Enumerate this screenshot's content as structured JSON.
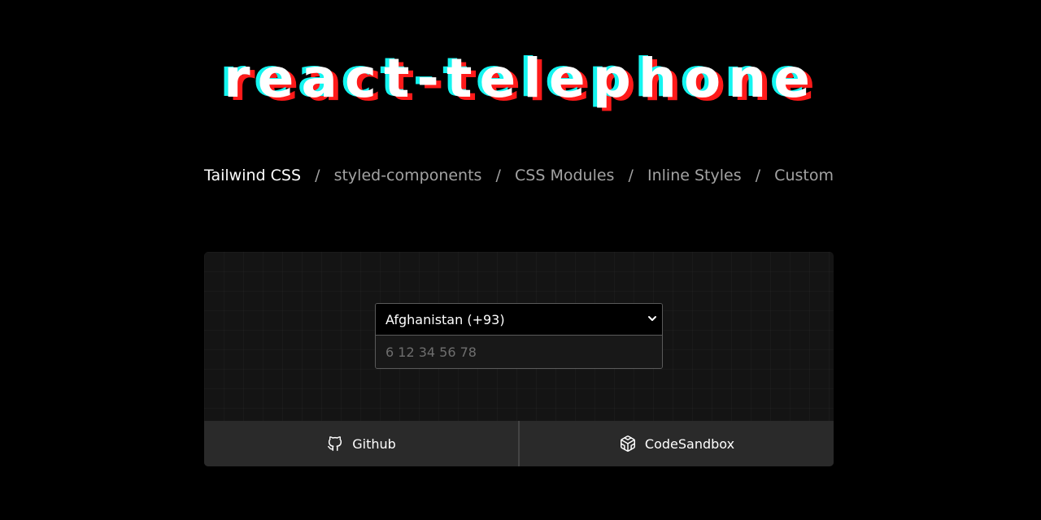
{
  "header": {
    "title": "react-telephone"
  },
  "nav": {
    "tabs": [
      {
        "label": "Tailwind CSS",
        "active": true
      },
      {
        "label": "styled-components",
        "active": false
      },
      {
        "label": "CSS Modules",
        "active": false
      },
      {
        "label": "Inline Styles",
        "active": false
      },
      {
        "label": "Custom",
        "active": false
      }
    ],
    "separator": "/"
  },
  "form": {
    "country_selected": "Afghanistan (+93)",
    "phone_placeholder": "6 12 34 56 78"
  },
  "footer": {
    "github_label": "Github",
    "github_icon": "github-icon",
    "codesandbox_label": "CodeSandbox",
    "codesandbox_icon": "codesandbox-icon"
  },
  "colors": {
    "background": "#000000",
    "card": "#141414",
    "glitch_red": "#ff1a1a",
    "glitch_cyan": "#14f5f0",
    "nav_inactive": "#a3a3a3",
    "nav_active": "#ffffff"
  }
}
